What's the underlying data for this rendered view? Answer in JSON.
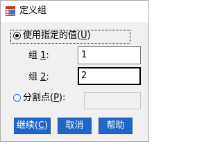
{
  "window": {
    "title": "定义组",
    "icon": "spss-grid-app-icon"
  },
  "options": {
    "specified_values": {
      "label": "使用指定的值(",
      "mnemonic": "U",
      "label_end": ")",
      "selected": true
    },
    "group1": {
      "label": "组 ",
      "mnemonic": "1",
      "label_end": ":",
      "value": "1"
    },
    "group2": {
      "label": "组 ",
      "mnemonic": "2",
      "label_end": ":",
      "value": "2"
    },
    "cut_point": {
      "label": "分割点(",
      "mnemonic": "P",
      "label_end": "):",
      "selected": false,
      "value": ""
    }
  },
  "buttons": {
    "continue": {
      "label": "继续(",
      "mnemonic": "C",
      "label_end": ")"
    },
    "cancel": {
      "label": "取消"
    },
    "help": {
      "label": "帮助"
    }
  },
  "colors": {
    "accent": "#1f66c7",
    "dialog_bg": "#f0f0f0"
  }
}
